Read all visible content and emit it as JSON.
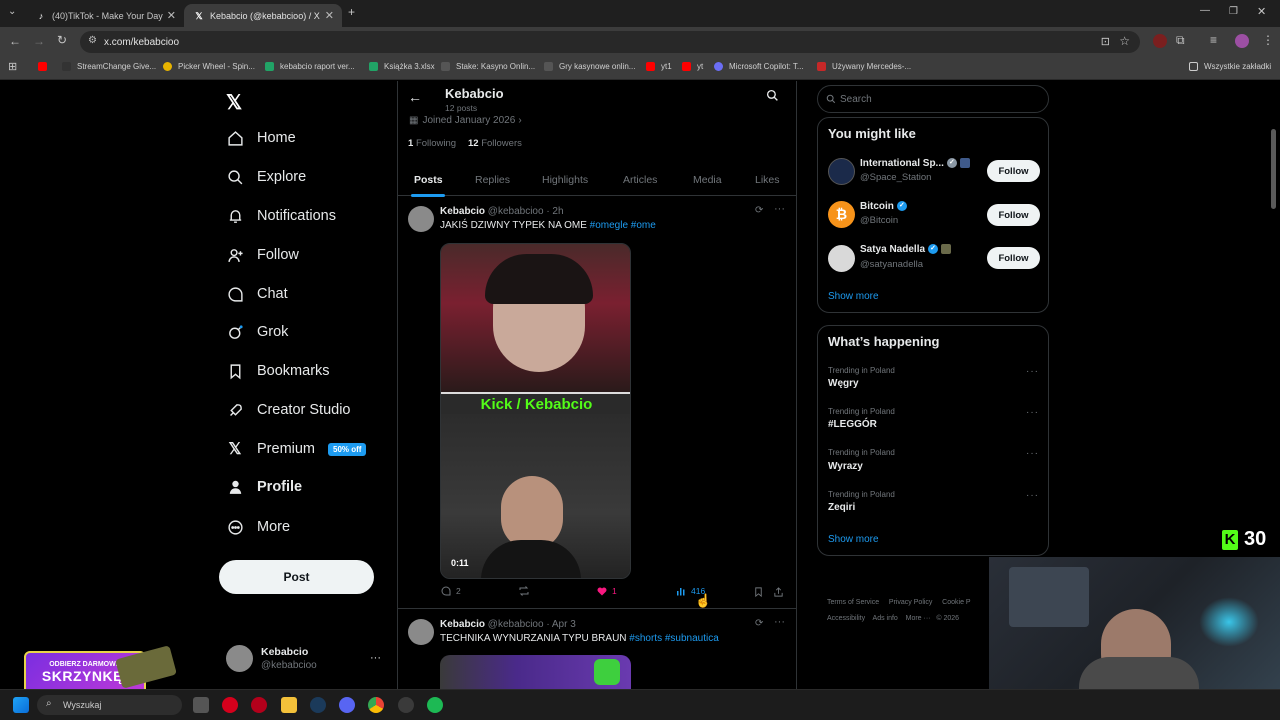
{
  "browser": {
    "tabs": [
      {
        "title": "(40)TikTok - Make Your Day",
        "active": false
      },
      {
        "title": "Kebabcio (@kebabcioo) / X",
        "active": true
      }
    ],
    "new_tab_label": "+",
    "url": "x.com/kebabcioo",
    "bookmarks": [
      {
        "label": "StreamChange Give...",
        "color": "#333333"
      },
      {
        "label": "Picker Wheel - Spin...",
        "color": "#e8b400"
      },
      {
        "label": "kebabcio raport ver...",
        "color": "#21a366"
      },
      {
        "label": "Książka 3.xlsx",
        "color": "#21a366"
      },
      {
        "label": "Stake: Kasyno Onlin...",
        "color": "#444444"
      },
      {
        "label": "Gry kasynowe onlin...",
        "color": "#444444"
      },
      {
        "label": "yt1",
        "color": "#ff0000"
      },
      {
        "label": "yt",
        "color": "#ff0000"
      },
      {
        "label": "Microsoft Copilot: T...",
        "color": "#6b6ef5"
      },
      {
        "label": "Używany Mercedes-...",
        "color": "#c62828"
      }
    ],
    "all_bookmarks": "Wszystkie zakładki"
  },
  "sidebar": {
    "items": [
      {
        "label": "Home",
        "icon": "home-icon"
      },
      {
        "label": "Explore",
        "icon": "search-icon"
      },
      {
        "label": "Notifications",
        "icon": "bell-icon"
      },
      {
        "label": "Follow",
        "icon": "person-add-icon"
      },
      {
        "label": "Chat",
        "icon": "chat-icon"
      },
      {
        "label": "Grok",
        "icon": "grok-icon"
      },
      {
        "label": "Bookmarks",
        "icon": "bookmark-icon"
      },
      {
        "label": "Creator Studio",
        "icon": "rocket-icon"
      },
      {
        "label": "Premium",
        "icon": "x-logo-icon"
      },
      {
        "label": "Profile",
        "icon": "person-icon"
      },
      {
        "label": "More",
        "icon": "more-circle-icon"
      }
    ],
    "premium_badge": "50% off",
    "post_button": "Post",
    "account": {
      "name": "Kebabcio",
      "handle": "@kebabcioo",
      "more": "···"
    }
  },
  "profile": {
    "name": "Kebabcio",
    "posts_count": "12 posts",
    "joined": "Joined January 2026",
    "following_count": "1",
    "following_label": "Following",
    "followers_count": "12",
    "followers_label": "Followers",
    "tabs": [
      "Posts",
      "Replies",
      "Highlights",
      "Articles",
      "Media",
      "Likes"
    ]
  },
  "posts": [
    {
      "author": "Kebabcio",
      "handle": "@kebabcioo",
      "time": "· 2h",
      "text": "JAKIŚ DZIWNY TYPEK NA OME",
      "hashtags": "#omegle #ome",
      "video_overlay": "Kick / Kebabcio",
      "video_duration": "0:11",
      "replies": "2",
      "likes": "1",
      "views": "416"
    },
    {
      "author": "Kebabcio",
      "handle": "@kebabcioo",
      "time": "· Apr 3",
      "text": "TECHNIKA WYNURZANIA TYPU BRAUN",
      "hashtags": "#shorts #subnautica"
    }
  ],
  "right": {
    "search_placeholder": "Search",
    "you_might_like": {
      "title": "You might like",
      "suggestions": [
        {
          "name": "International Sp...",
          "handle": "@Space_Station",
          "button": "Follow",
          "avatar_color": "#1b2a4a"
        },
        {
          "name": "Bitcoin",
          "handle": "@Bitcoin",
          "button": "Follow",
          "avatar_color": "#f7931a"
        },
        {
          "name": "Satya Nadella",
          "handle": "@satyanadella",
          "button": "Follow",
          "avatar_color": "#d9d9d9"
        }
      ],
      "show_more": "Show more"
    },
    "whats_happening": {
      "title": "What’s happening",
      "trends": [
        {
          "context": "Trending in Poland",
          "name": "Węgry"
        },
        {
          "context": "Trending in Poland",
          "name": "#LEGGÓR"
        },
        {
          "context": "Trending in Poland",
          "name": "Wyrazy"
        },
        {
          "context": "Trending in Poland",
          "name": "Zeqiri"
        }
      ],
      "show_more": "Show more"
    },
    "footer": {
      "line1": [
        "Terms of Service",
        "Privacy Policy",
        "Cookie P"
      ],
      "line2": [
        "Accessibility",
        "Ads info",
        "More ···",
        "© 2026"
      ]
    }
  },
  "overlays": {
    "kick_count": "30",
    "promo_line1": "ODBIERZ DARMOWĄ",
    "promo_line2": "SKRZYNKĘ!"
  },
  "taskbar": {
    "search_placeholder": "Wyszukaj"
  },
  "colors": {
    "accent": "#1d9bf0",
    "like": "#f91880",
    "kick_green": "#53fc18"
  }
}
